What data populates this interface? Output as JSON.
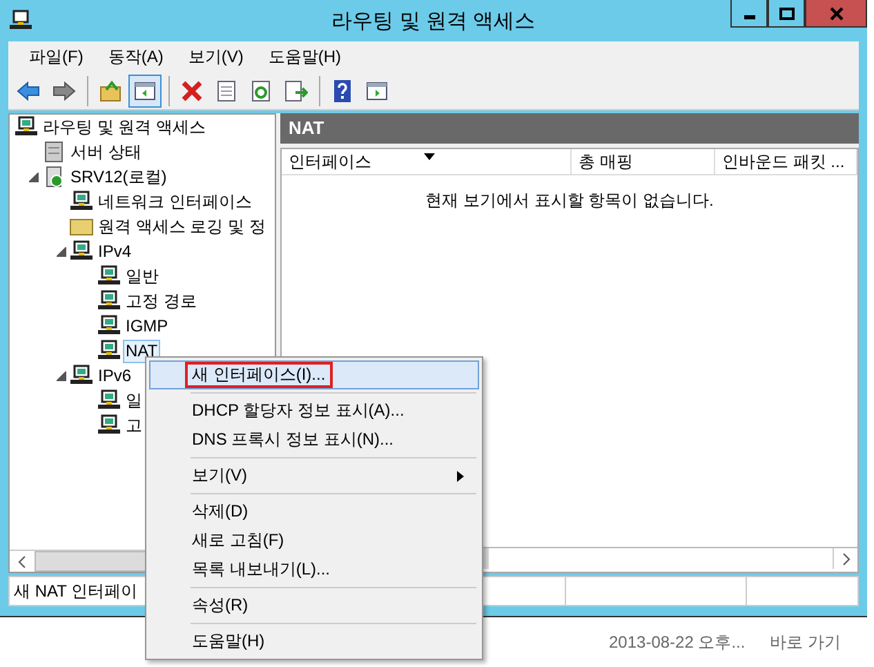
{
  "window": {
    "title": "라우팅 및 원격 액세스"
  },
  "menu_bar": [
    "파일(F)",
    "동작(A)",
    "보기(V)",
    "도움말(H)"
  ],
  "toolbar": [
    [
      {
        "kind": "back",
        "pressed": false
      },
      {
        "kind": "forward",
        "pressed": false
      }
    ],
    [
      {
        "kind": "up",
        "pressed": false
      },
      {
        "kind": "tree",
        "pressed": true
      }
    ],
    [
      {
        "kind": "delete",
        "pressed": false
      },
      {
        "kind": "properties",
        "pressed": false
      },
      {
        "kind": "refresh",
        "pressed": false
      },
      {
        "kind": "export",
        "pressed": false
      }
    ],
    [
      {
        "kind": "help",
        "pressed": false
      },
      {
        "kind": "pane",
        "pressed": false
      }
    ]
  ],
  "tree": [
    {
      "label": "라우팅 및 원격 액세스",
      "selected": false,
      "children": [
        {
          "label": "서버 상태",
          "selected": false
        },
        {
          "label": "SRV12(로컬)",
          "selected": false,
          "expanded": true,
          "children": [
            {
              "label": "네트워크 인터페이스",
              "selected": false
            },
            {
              "label": "원격 액세스 로깅 및 정",
              "selected": false
            },
            {
              "label": "IPv4",
              "selected": false,
              "expanded": true,
              "children": [
                {
                  "label": "일반",
                  "selected": false
                },
                {
                  "label": "고정 경로",
                  "selected": false
                },
                {
                  "label": "IGMP",
                  "selected": false
                },
                {
                  "label": "NAT",
                  "selected": true
                }
              ]
            },
            {
              "label": "IPv6",
              "selected": false,
              "expanded": true,
              "children": [
                {
                  "label": "일",
                  "selected": false
                },
                {
                  "label": "고",
                  "selected": false
                }
              ]
            }
          ]
        }
      ]
    }
  ],
  "details": {
    "header": "NAT",
    "columns": [
      {
        "label": "인터페이스",
        "sorted": true
      },
      {
        "label": "총 매핑",
        "sorted": false
      },
      {
        "label": "인바운드 패킷 ...",
        "sorted": false
      }
    ],
    "empty_message": "현재 보기에서 표시할 항목이 없습니다."
  },
  "status_bar": "새 NAT 인터페이",
  "context_menu": [
    [
      {
        "label": "새 인터페이스(I)...",
        "selected": true,
        "outlined": true,
        "submenu": false
      }
    ],
    [
      {
        "label": "DHCP 할당자 정보 표시(A)...",
        "selected": false,
        "outlined": false,
        "submenu": false
      },
      {
        "label": "DNS 프록시 정보 표시(N)...",
        "selected": false,
        "outlined": false,
        "submenu": false
      }
    ],
    [
      {
        "label": "보기(V)",
        "selected": false,
        "outlined": false,
        "submenu": true
      }
    ],
    [
      {
        "label": "삭제(D)",
        "selected": false,
        "outlined": false,
        "submenu": false
      },
      {
        "label": "새로 고침(F)",
        "selected": false,
        "outlined": false,
        "submenu": false
      },
      {
        "label": "목록 내보내기(L)...",
        "selected": false,
        "outlined": false,
        "submenu": false
      }
    ],
    [
      {
        "label": "속성(R)",
        "selected": false,
        "outlined": false,
        "submenu": false
      }
    ],
    [
      {
        "label": "도움말(H)",
        "selected": false,
        "outlined": false,
        "submenu": false
      }
    ]
  ],
  "background_window": {
    "rows": [
      {
        "date": "2013-08-22 오후...",
        "type": "바로 가기"
      }
    ]
  }
}
